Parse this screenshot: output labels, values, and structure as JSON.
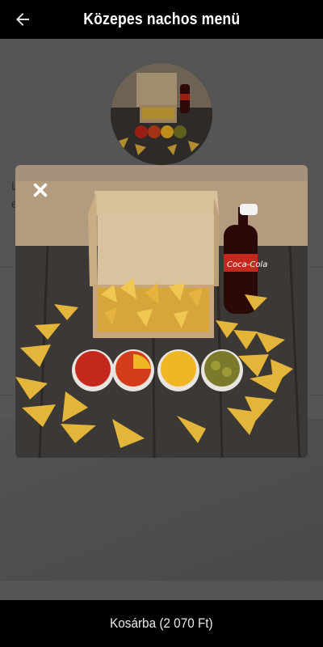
{
  "header": {
    "title": "Közepes nachos menü",
    "back_icon": "arrow-left-icon"
  },
  "product": {
    "peek_text_line1": "L",
    "peek_text_line2": "e"
  },
  "modal": {
    "close_icon": "close-icon",
    "image_alt": "Közepes nachos menü"
  },
  "footer": {
    "add_to_cart_label": "Kosárba (2 070 Ft)"
  },
  "colors": {
    "bar": "#000000",
    "overlay": "#6e6e6e",
    "chip": "#e3b53a",
    "salsa": "#c4281c",
    "cheese": "#f0b624",
    "jalapeno": "#8a8a28"
  }
}
